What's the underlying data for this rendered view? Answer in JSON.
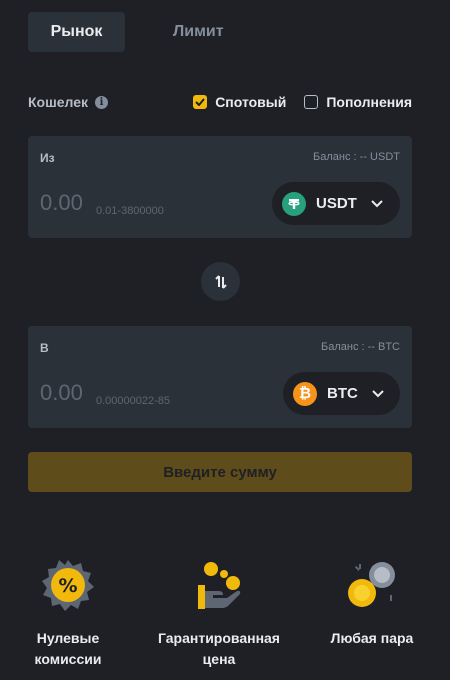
{
  "tabs": {
    "market": "Рынок",
    "limit": "Лимит"
  },
  "wallet": {
    "label": "Кошелек",
    "info_icon": "i",
    "options": [
      {
        "label": "Спотовый",
        "checked": true
      },
      {
        "label": "Пополнения",
        "checked": false
      }
    ]
  },
  "from": {
    "label": "Из",
    "balance": "Баланс : -- USDT",
    "amount_placeholder": "0.00",
    "range": "0.01-3800000",
    "coin": "USDT",
    "coin_icon": "tether-icon",
    "coin_color": "#26a17b"
  },
  "to": {
    "label": "В",
    "balance": "Баланс : -- BTC",
    "amount_placeholder": "0.00",
    "range": "0.00000022-85",
    "coin": "BTC",
    "coin_icon": "bitcoin-icon",
    "coin_color": "#f7931a"
  },
  "swap_icon": "swap-arrows-icon",
  "submit_label": "Введите сумму",
  "features": [
    {
      "icon": "percent-badge-icon",
      "line1": "Нулевые",
      "line2": "комиссии"
    },
    {
      "icon": "hand-coins-icon",
      "line1": "Гарантированная",
      "line2": "цена"
    },
    {
      "icon": "coin-pair-icon",
      "line1": "Любая пара",
      "line2": ""
    }
  ],
  "colors": {
    "accent": "#f0b90b",
    "background": "#1e2026",
    "panel": "#2b3139"
  }
}
